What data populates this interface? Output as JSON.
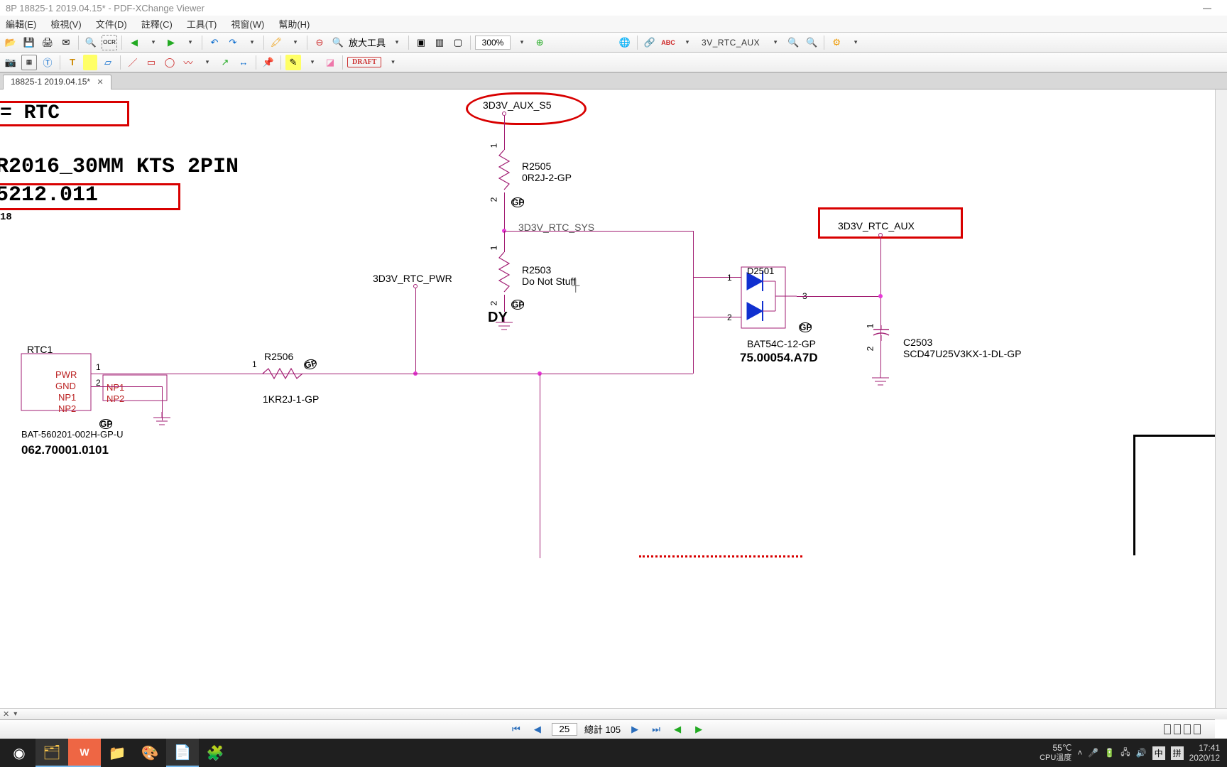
{
  "window": {
    "title": "8P 18825-1 2019.04.15* - PDF-XChange Viewer",
    "minimize": "—"
  },
  "menu": {
    "edit": "編輯(E)",
    "view": "檢視(V)",
    "document": "文件(D)",
    "comment": "註釋(C)",
    "tools": "工具(T)",
    "window": "視窗(W)",
    "help": "幫助(H)"
  },
  "toolbar1": {
    "zoom_tool_label": "放大工具",
    "zoom_value": "300%",
    "ocr": "OCR",
    "link_dropdown": "3V_RTC_AUX"
  },
  "toolbar2": {
    "draft": "DRAFT"
  },
  "tab": {
    "label": "18825-1 2019.04.15*"
  },
  "nav": {
    "current_page": "25",
    "total_label": "總計 105"
  },
  "footer_left": {
    "hint": "✕"
  },
  "schematic": {
    "title_eq": "= RTC",
    "title_line1": "R2016_30MM KTS 2PIN",
    "title_line2": "5212.011",
    "title_small": "18",
    "net_aux_s5": "3D3V_AUX_S5",
    "r2505": "R2505",
    "r2505_val": "0R2J-2-GP",
    "net_rtc_sys": "3D3V_RTC_SYS",
    "r2503": "R2503",
    "r2503_val": "Do Not Stuff",
    "dy": "DY",
    "net_rtc_pwr": "3D3V_RTC_PWR",
    "r2506": "R2506",
    "r2506_val": "1KR2J-1-GP",
    "d2501": "D2501",
    "d2501_val": "BAT54C-12-GP",
    "d2501_pn": "75.00054.A7D",
    "net_rtc_aux": "3D3V_RTC_AUX",
    "c2503": "C2503",
    "c2503_val": "SCD47U25V3KX-1-DL-GP",
    "rtc1": "RTC1",
    "rtc1_pwr": "PWR",
    "rtc1_gnd": "GND",
    "rtc1_np1": "NP1",
    "rtc1_np2": "NP2",
    "rtc1_np1b": "NP1",
    "rtc1_np2b": "NP2",
    "rtc1_val": "BAT-560201-002H-GP-U",
    "rtc1_pn": "062.70001.0101",
    "pin1": "1",
    "pin2": "2",
    "pin3": "3",
    "gp": "GP"
  },
  "taskbar": {
    "temp": "55℃",
    "cpu_label": "CPU溫度",
    "ime_cn": "中",
    "ime_mode": "拼",
    "time": "17:41",
    "date": "2020/12"
  }
}
